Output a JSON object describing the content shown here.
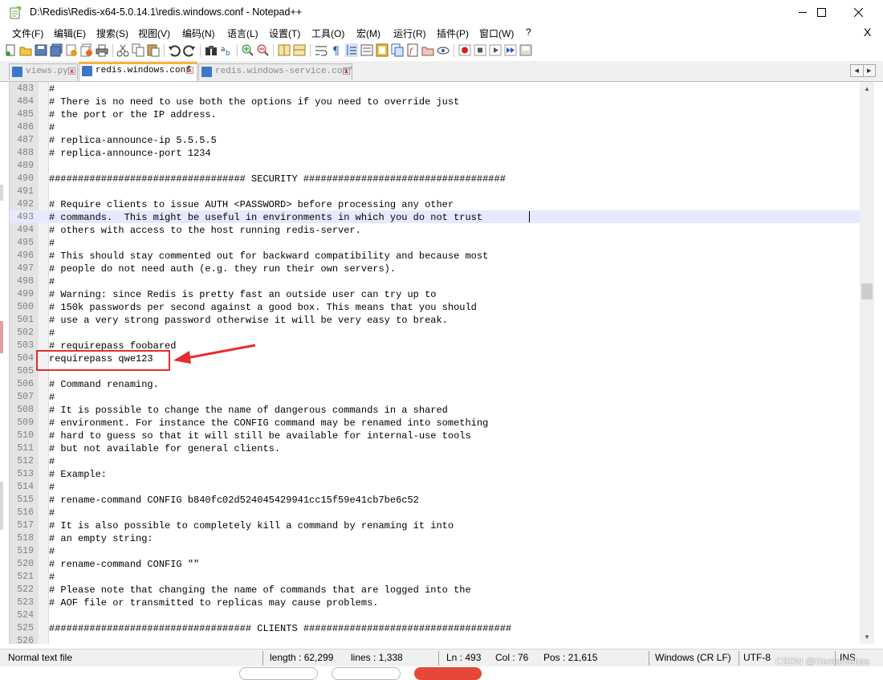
{
  "window": {
    "title": "D:\\Redis\\Redis-x64-5.0.14.1\\redis.windows.conf - Notepad++"
  },
  "menu": [
    "文件(F)",
    "编辑(E)",
    "搜索(S)",
    "视图(V)",
    "编码(N)",
    "语言(L)",
    "设置(T)",
    "工具(O)",
    "宏(M)",
    "运行(R)",
    "插件(P)",
    "窗口(W)",
    "?"
  ],
  "menu_close": "X",
  "tabs": [
    {
      "label": "views.py",
      "close": "x",
      "active": false
    },
    {
      "label": "redis.windows.conf",
      "close": "x",
      "active": true
    },
    {
      "label": "redis.windows-service.conf",
      "close": "x",
      "active": false
    }
  ],
  "editor": {
    "current_line": 493,
    "lines": [
      {
        "n": "483",
        "t": "#"
      },
      {
        "n": "484",
        "t": "# There is no need to use both the options if you need to override just"
      },
      {
        "n": "485",
        "t": "# the port or the IP address."
      },
      {
        "n": "486",
        "t": "#"
      },
      {
        "n": "487",
        "t": "# replica-announce-ip 5.5.5.5"
      },
      {
        "n": "488",
        "t": "# replica-announce-port 1234"
      },
      {
        "n": "489",
        "t": ""
      },
      {
        "n": "490",
        "t": "################################## SECURITY ###################################"
      },
      {
        "n": "491",
        "t": ""
      },
      {
        "n": "492",
        "t": "# Require clients to issue AUTH <PASSWORD> before processing any other"
      },
      {
        "n": "493",
        "t": "# commands.  This might be useful in environments in which you do not trust"
      },
      {
        "n": "494",
        "t": "# others with access to the host running redis-server."
      },
      {
        "n": "495",
        "t": "#"
      },
      {
        "n": "496",
        "t": "# This should stay commented out for backward compatibility and because most"
      },
      {
        "n": "497",
        "t": "# people do not need auth (e.g. they run their own servers)."
      },
      {
        "n": "498",
        "t": "#"
      },
      {
        "n": "499",
        "t": "# Warning: since Redis is pretty fast an outside user can try up to"
      },
      {
        "n": "500",
        "t": "# 150k passwords per second against a good box. This means that you should"
      },
      {
        "n": "501",
        "t": "# use a very strong password otherwise it will be very easy to break."
      },
      {
        "n": "502",
        "t": "#"
      },
      {
        "n": "503",
        "t": "# requirepass foobared"
      },
      {
        "n": "504",
        "t": "requirepass qwe123"
      },
      {
        "n": "505",
        "t": ""
      },
      {
        "n": "506",
        "t": "# Command renaming."
      },
      {
        "n": "507",
        "t": "#"
      },
      {
        "n": "508",
        "t": "# It is possible to change the name of dangerous commands in a shared"
      },
      {
        "n": "509",
        "t": "# environment. For instance the CONFIG command may be renamed into something"
      },
      {
        "n": "510",
        "t": "# hard to guess so that it will still be available for internal-use tools"
      },
      {
        "n": "511",
        "t": "# but not available for general clients."
      },
      {
        "n": "512",
        "t": "#"
      },
      {
        "n": "513",
        "t": "# Example:"
      },
      {
        "n": "514",
        "t": "#"
      },
      {
        "n": "515",
        "t": "# rename-command CONFIG b840fc02d524045429941cc15f59e41cb7be6c52"
      },
      {
        "n": "516",
        "t": "#"
      },
      {
        "n": "517",
        "t": "# It is also possible to completely kill a command by renaming it into"
      },
      {
        "n": "518",
        "t": "# an empty string:"
      },
      {
        "n": "519",
        "t": "#"
      },
      {
        "n": "520",
        "t": "# rename-command CONFIG \"\""
      },
      {
        "n": "521",
        "t": "#"
      },
      {
        "n": "522",
        "t": "# Please note that changing the name of commands that are logged into the"
      },
      {
        "n": "523",
        "t": "# AOF file or transmitted to replicas may cause problems."
      },
      {
        "n": "524",
        "t": ""
      },
      {
        "n": "525",
        "t": "################################### CLIENTS ####################################"
      },
      {
        "n": "526",
        "t": ""
      }
    ]
  },
  "status": {
    "file_type": "Normal text file",
    "length": "length : 62,299",
    "lines": "lines : 1,338",
    "ln": "Ln : 493",
    "col": "Col : 76",
    "pos": "Pos : 21,615",
    "eol": "Windows (CR LF)",
    "encoding": "UTF-8",
    "mode": "INS"
  },
  "watermark": "CSDN @Hemamebas",
  "colors": {
    "annotation": "#e52d2d",
    "active_tab_accent": "#fab23c",
    "current_line": "#e8e8ff"
  }
}
